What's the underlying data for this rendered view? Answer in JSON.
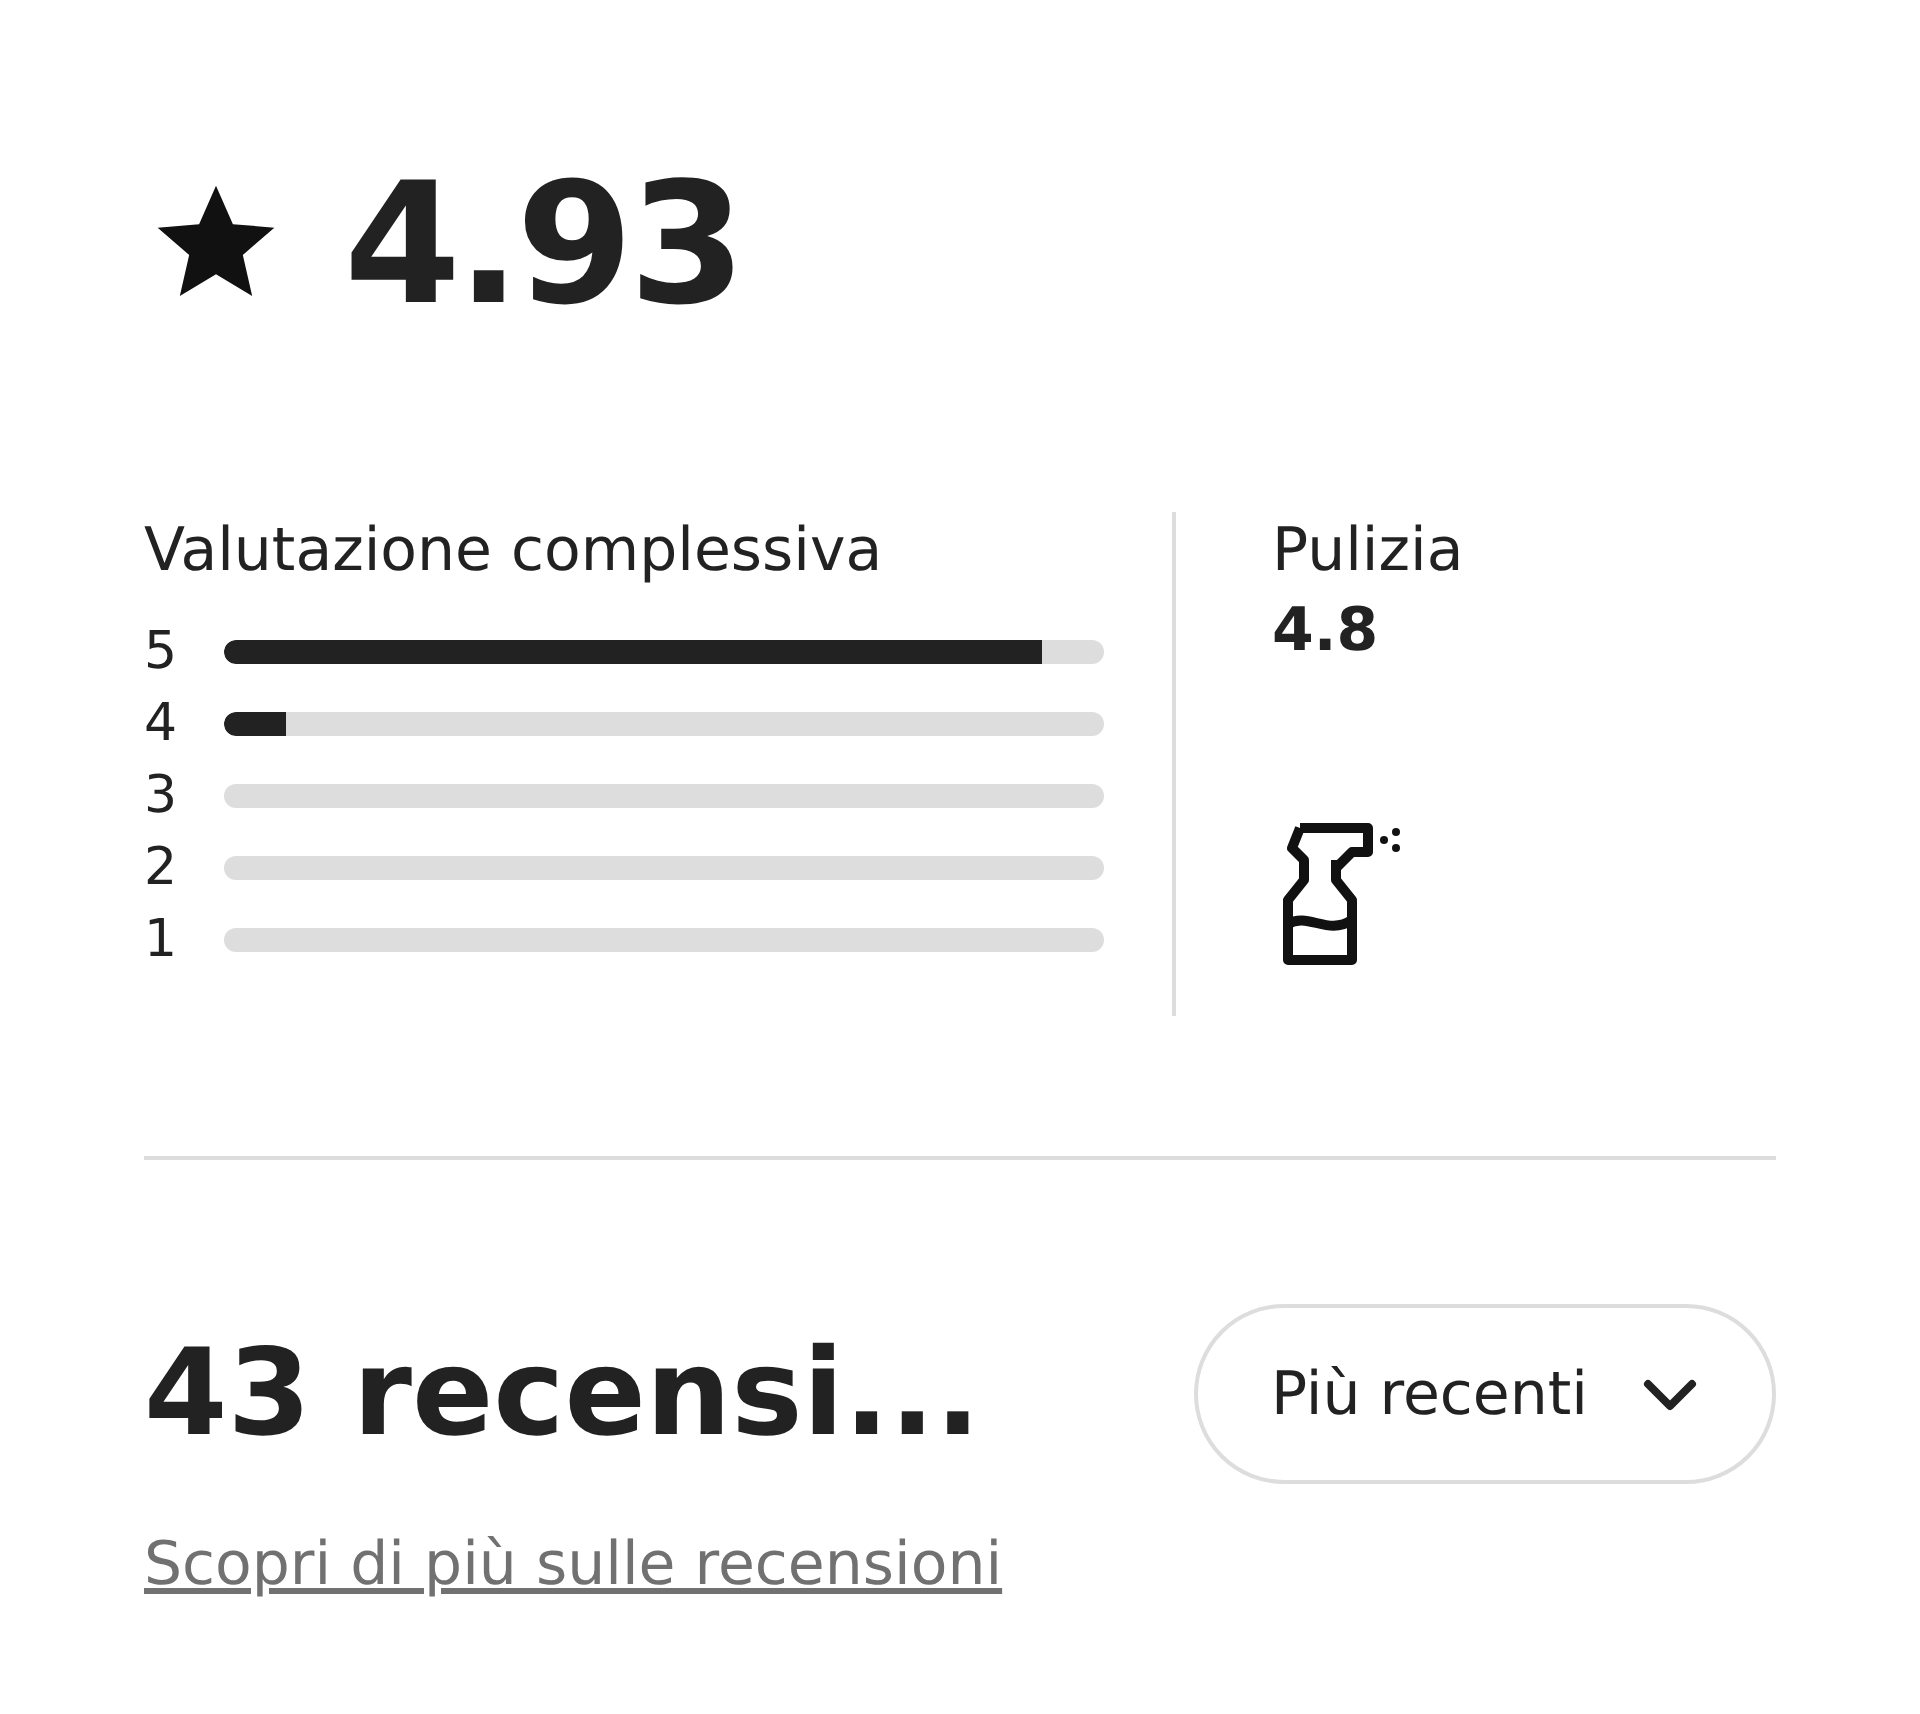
{
  "rating": {
    "value": "4.93"
  },
  "overall": {
    "title": "Valutazione complessiva",
    "bars": [
      {
        "label": "5",
        "level": 0.93
      },
      {
        "label": "4",
        "level": 0.07
      },
      {
        "label": "3",
        "level": 0
      },
      {
        "label": "2",
        "level": 0
      },
      {
        "label": "1",
        "level": 0
      }
    ]
  },
  "category": {
    "name": "Pulizia",
    "score": "4.8"
  },
  "reviews": {
    "title": "43 recensi...",
    "sort": "Più recenti",
    "link": "Scopri di più sulle recensioni"
  }
}
